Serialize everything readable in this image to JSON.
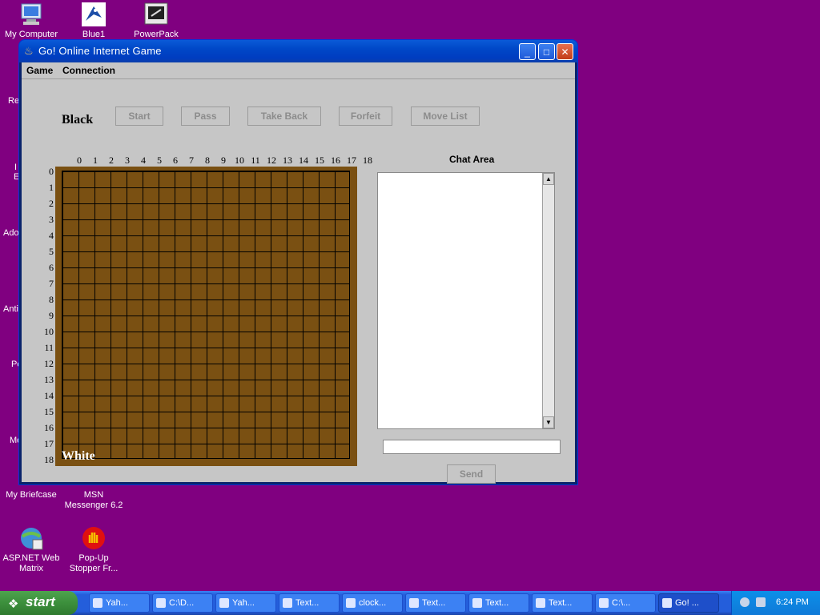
{
  "desktop": {
    "icons": [
      {
        "label": "My Computer",
        "icon": "computer-icon"
      },
      {
        "label": "Blue1",
        "icon": "blue-bird-icon"
      },
      {
        "label": "PowerPack",
        "icon": "powerpack-icon"
      },
      {
        "label": "My Briefcase",
        "icon": "briefcase-icon"
      },
      {
        "label": "MSN Messenger 6.2",
        "icon": "msn-icon"
      },
      {
        "label": "ASP.NET Web Matrix",
        "icon": "web-matrix-icon"
      },
      {
        "label": "Pop-Up Stopper Fr...",
        "icon": "popup-stopper-icon"
      }
    ],
    "partial_labels": [
      "Re",
      "I",
      "E",
      "Ado",
      "Anti",
      "Pe",
      "Me"
    ]
  },
  "window": {
    "title": "Go! Online Internet Game",
    "controls": {
      "minimize": "_",
      "maximize": "□",
      "close": "✕"
    },
    "menu": [
      "Game",
      "Connection"
    ],
    "toolbar": [
      "Start",
      "Pass",
      "Take Back",
      "Forfeit",
      "Move List"
    ],
    "players": {
      "top": "Black",
      "bottom": "White"
    },
    "board": {
      "col_labels": [
        "0",
        "1",
        "2",
        "3",
        "4",
        "5",
        "6",
        "7",
        "8",
        "9",
        "10",
        "11",
        "12",
        "13",
        "14",
        "15",
        "16",
        "17",
        "18"
      ],
      "row_labels": [
        "0",
        "1",
        "2",
        "3",
        "4",
        "5",
        "6",
        "7",
        "8",
        "9",
        "10",
        "11",
        "12",
        "13",
        "14",
        "15",
        "16",
        "17",
        "18"
      ],
      "color": "#7a5012"
    },
    "chat": {
      "title": "Chat Area",
      "scroll_up": "▲",
      "scroll_down": "▼",
      "send_label": "Send"
    }
  },
  "taskbar": {
    "start_label": "start",
    "tasks": [
      "Yah...",
      "C:\\D...",
      "Yah...",
      "Text...",
      "clock...",
      "Text...",
      "Text...",
      "Text...",
      "C:\\...",
      "Go! ..."
    ],
    "clock": "6:24 PM"
  }
}
